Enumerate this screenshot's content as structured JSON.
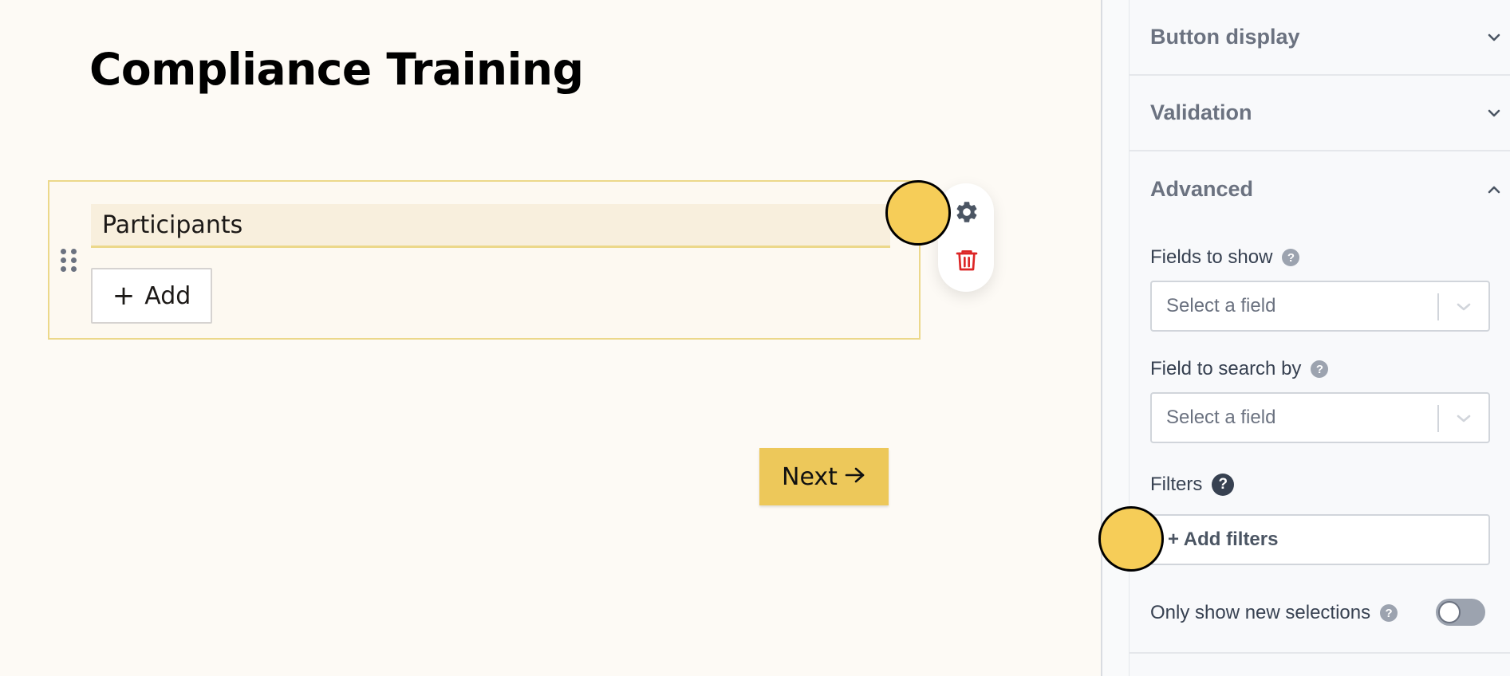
{
  "canvas": {
    "page_title": "Compliance Training",
    "field": {
      "label": "Participants",
      "add_button_label": "Add",
      "add_button_icon": "plus-icon"
    },
    "toolbar": {
      "settings_icon": "gear-icon",
      "delete_icon": "trash-icon",
      "delete_color": "#dc2626"
    },
    "next_button": {
      "label": "Next",
      "icon": "arrow-right-icon"
    }
  },
  "panel": {
    "sections": [
      {
        "title": "Button display",
        "expanded": false
      },
      {
        "title": "Validation",
        "expanded": false
      },
      {
        "title": "Advanced",
        "expanded": true
      }
    ],
    "advanced": {
      "fields_to_show": {
        "label": "Fields to show",
        "placeholder": "Select a field"
      },
      "field_to_search_by": {
        "label": "Field to search by",
        "placeholder": "Select a field"
      },
      "filters": {
        "label": "Filters",
        "button_label": "+ Add filters"
      },
      "only_show_new_selections": {
        "label": "Only show new selections",
        "enabled": false
      }
    }
  },
  "colors": {
    "accent": "#edc85a",
    "block_border": "#ecd88a",
    "cursor_marker": "#f6cd58"
  }
}
